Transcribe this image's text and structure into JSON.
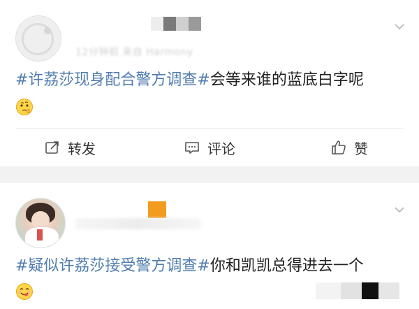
{
  "posts": [
    {
      "meta_text": "12分钟前 来自 Harmony",
      "content": {
        "topic": "#许荔莎现身配合警方调查#",
        "text": "会等来谁的蓝底白字呢"
      },
      "emoji": "thinking-face",
      "actions": {
        "repost_label": "转发",
        "comment_label": "评论",
        "like_label": "赞"
      }
    },
    {
      "content": {
        "topic": "#疑似许荔莎接受警方调查#",
        "text": "你和凯凯总得进去一个"
      },
      "emoji": "yum-face"
    }
  ],
  "colors": {
    "topic_link": "#507daf",
    "separator": "#f2f2f2",
    "username_badge": "#f39b1f"
  },
  "icons": [
    "chevron-down-icon",
    "repost-icon",
    "comment-icon",
    "like-icon"
  ]
}
